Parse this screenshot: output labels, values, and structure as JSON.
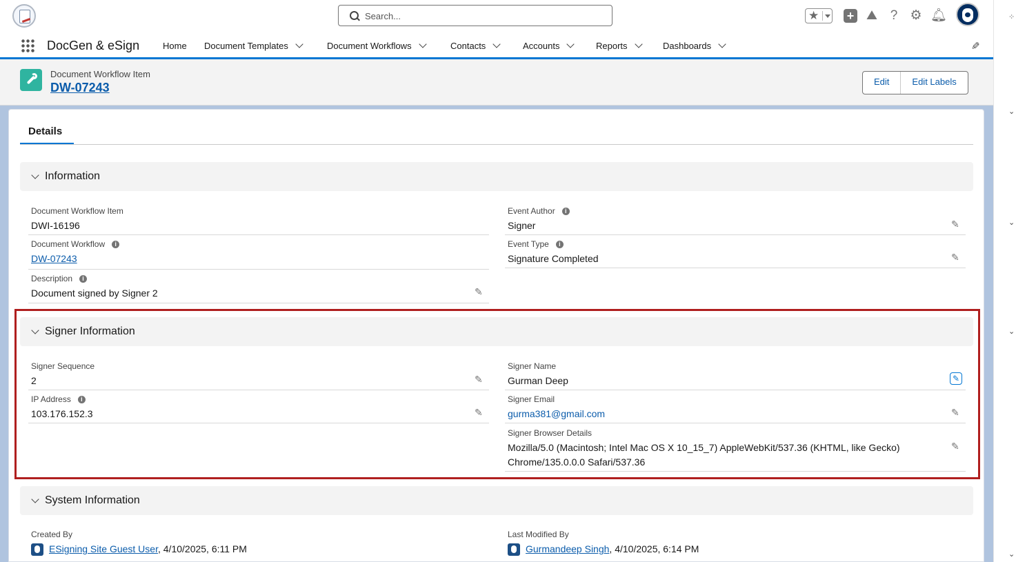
{
  "header": {
    "search_placeholder": "Search...",
    "app_name": "DocGen & eSign",
    "nav_items": [
      {
        "label": "Home",
        "has_menu": false
      },
      {
        "label": "Document Templates",
        "has_menu": true
      },
      {
        "label": "Document Workflows",
        "has_menu": true
      },
      {
        "label": "Contacts",
        "has_menu": true
      },
      {
        "label": "Accounts",
        "has_menu": true
      },
      {
        "label": "Reports",
        "has_menu": true
      },
      {
        "label": "Dashboards",
        "has_menu": true
      }
    ],
    "icons": [
      "favorites-star-icon",
      "global-actions-plus-icon",
      "trailhead-icon",
      "help-icon",
      "setup-gear-icon",
      "notifications-bell-icon",
      "user-avatar"
    ]
  },
  "record": {
    "object_type": "Document Workflow Item",
    "title": "DW-07243",
    "buttons": {
      "edit": "Edit",
      "edit_labels": "Edit Labels"
    }
  },
  "tabs": {
    "details": "Details"
  },
  "sections": {
    "information": {
      "title": "Information",
      "fields": {
        "item": {
          "label": "Document Workflow Item",
          "value": "DWI-16196"
        },
        "workflow": {
          "label": "Document Workflow",
          "value": "DW-07243"
        },
        "description": {
          "label": "Description",
          "value": "Document signed by Signer 2"
        },
        "event_author": {
          "label": "Event Author",
          "value": "Signer"
        },
        "event_type": {
          "label": "Event Type",
          "value": "Signature Completed"
        }
      }
    },
    "signer": {
      "title": "Signer Information",
      "fields": {
        "sequence": {
          "label": "Signer Sequence",
          "value": "2"
        },
        "ip": {
          "label": "IP Address",
          "value": "103.176.152.3"
        },
        "name": {
          "label": "Signer Name",
          "value": "Gurman Deep"
        },
        "email": {
          "label": "Signer Email",
          "value": "gurma381@gmail.com"
        },
        "browser": {
          "label": "Signer Browser Details",
          "value": "Mozilla/5.0 (Macintosh; Intel Mac OS X 10_15_7) AppleWebKit/537.36 (KHTML, like Gecko) Chrome/135.0.0.0 Safari/537.36"
        }
      }
    },
    "system": {
      "title": "System Information",
      "fields": {
        "created_by": {
          "label": "Created By",
          "user": "ESigning Site Guest User",
          "date": ", 4/10/2025, 6:11 PM"
        },
        "modified_by": {
          "label": "Last Modified By",
          "user": "Gurmandeep Singh",
          "date": ", 4/10/2025, 6:14 PM"
        }
      }
    }
  },
  "colors": {
    "brand": "#0176d3",
    "link": "#0b5cab",
    "highlight_border": "#b01f1f",
    "object_icon": "#2fb4a0"
  }
}
